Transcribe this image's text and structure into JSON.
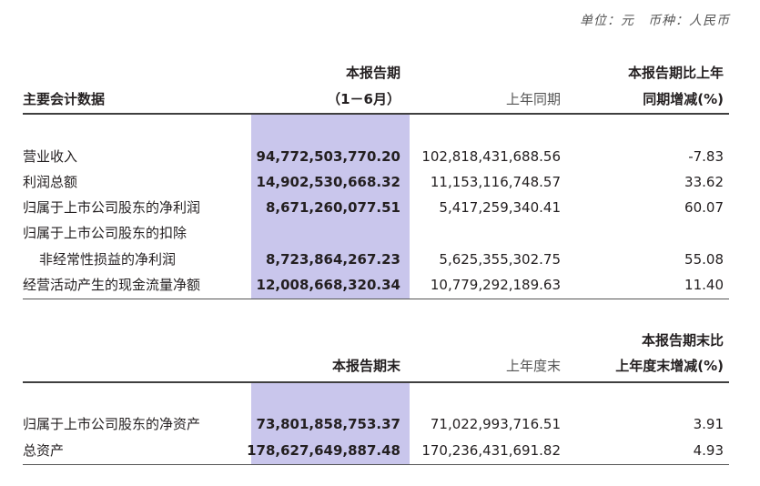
{
  "unit_note": "单位：元　币种：人民币",
  "table1": {
    "header": {
      "label_col": "主要会计数据",
      "current_line1": "本报告期",
      "current_line2": "（1－6月）",
      "prior": "上年同期",
      "change_line1": "本报告期比上年",
      "change_line2": "同期增减(%)"
    },
    "rows": [
      {
        "label": "营业收入",
        "current": "94,772,503,770.20",
        "prior": "102,818,431,688.56",
        "change": "-7.83"
      },
      {
        "label": "利润总额",
        "current": "14,902,530,668.32",
        "prior": "11,153,116,748.57",
        "change": "33.62"
      },
      {
        "label": "归属于上市公司股东的净利润",
        "current": "8,671,260,077.51",
        "prior": "5,417,259,340.41",
        "change": "60.07"
      },
      {
        "label": "归属于上市公司股东的扣除"
      },
      {
        "label": "非经常性损益的净利润",
        "current": "8,723,864,267.23",
        "prior": "5,625,355,302.75",
        "change": "55.08"
      },
      {
        "label": "经营活动产生的现金流量净额",
        "current": "12,008,668,320.34",
        "prior": "10,779,292,189.63",
        "change": "11.40"
      }
    ]
  },
  "table2": {
    "header": {
      "current": "本报告期末",
      "prior": "上年度末",
      "change_line1": "本报告期末比",
      "change_line2": "上年度末增减(%)"
    },
    "rows": [
      {
        "label": "归属于上市公司股东的净资产",
        "current": "73,801,858,753.37",
        "prior": "71,022,993,716.51",
        "change": "3.91"
      },
      {
        "label": "总资产",
        "current": "178,627,649,887.48",
        "prior": "170,236,431,691.82",
        "change": "4.93"
      }
    ]
  },
  "colors": {
    "highlight": "#c9c6ec",
    "rule": "#3f3f3f"
  }
}
